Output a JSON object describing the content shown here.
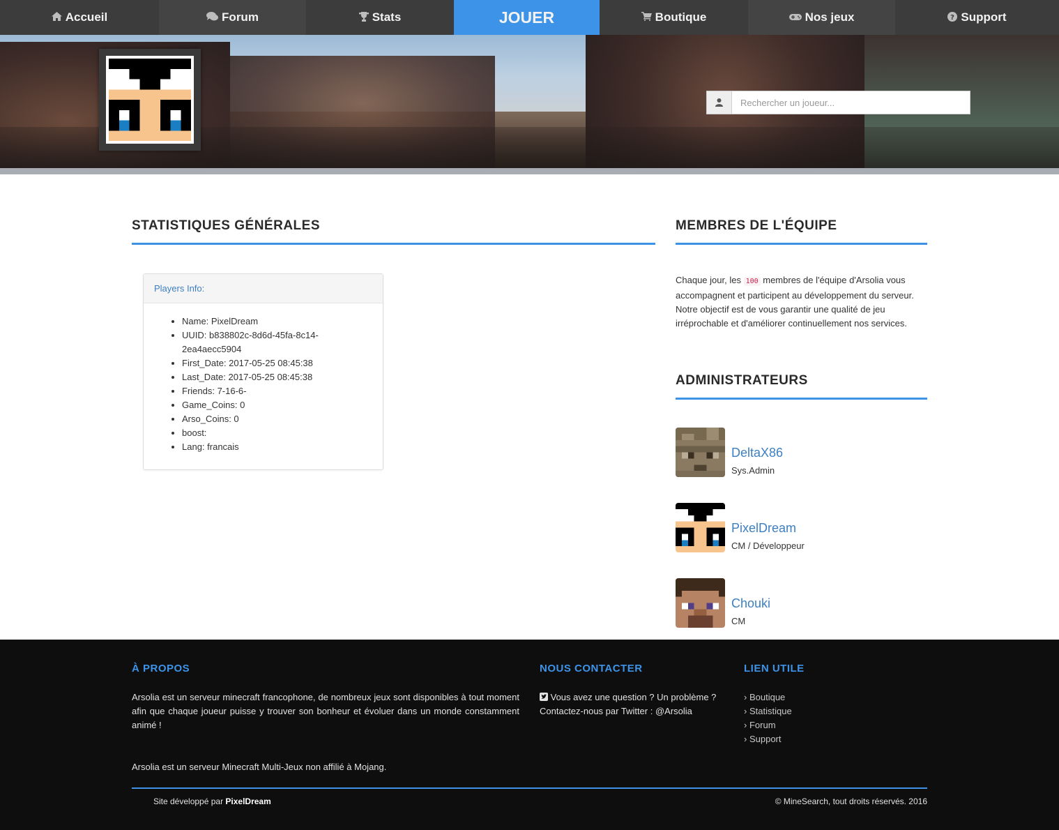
{
  "nav": {
    "items": [
      {
        "label": "Accueil",
        "icon": "home-icon"
      },
      {
        "label": "Forum",
        "icon": "comments-icon"
      },
      {
        "label": "Stats",
        "icon": "trophy-icon"
      },
      {
        "label": "JOUER",
        "icon": ""
      },
      {
        "label": "Boutique",
        "icon": "cart-icon"
      },
      {
        "label": "Nos jeux",
        "icon": "gamepad-icon"
      },
      {
        "label": "Support",
        "icon": "question-circle-icon"
      }
    ],
    "active_index": 3,
    "accent_color": "#3d93e8"
  },
  "header": {
    "search_placeholder": "Rechercher un joueur..."
  },
  "stats": {
    "title": "STATISTIQUES GÉNÉRALES",
    "panel_title": "Players Info:",
    "items": [
      "Name: PixelDream",
      "UUID: b838802c-8d6d-45fa-8c14-2ea4aecc5904",
      "First_Date: 2017-05-25 08:45:38",
      "Last_Date: 2017-05-25 08:45:38",
      "Friends: 7-16-6-",
      "Game_Coins: 0",
      "Arso_Coins: 0",
      "boost:",
      "Lang: francais"
    ]
  },
  "team": {
    "title": "MEMBRES DE L'ÉQUIPE",
    "text_before": "Chaque jour, les ",
    "count": "100",
    "text_after": " membres de l'équipe d'Arsolia vous accompagnent et participent au développement du serveur. Notre objectif est de vous garantir une qualité de jeu irréprochable et d'améliorer continuellement nos services.",
    "admins_title": "ADMINISTRATEURS",
    "members": [
      {
        "name": "DeltaX86",
        "role": "Sys.Admin"
      },
      {
        "name": "PixelDream",
        "role": "CM / Développeur"
      },
      {
        "name": "Chouki",
        "role": "CM"
      }
    ]
  },
  "footer": {
    "about_title": "À PROPOS",
    "about_text": "Arsolia est un serveur minecraft francophone, de nombreux jeux sont disponibles à tout moment afin que chaque joueur puisse y trouver son bonheur et évoluer dans un monde constamment animé !",
    "disclaimer": "Arsolia est un serveur Minecraft Multi-Jeux non affilié à Mojang.",
    "contact_title": "NOUS CONTACTER",
    "contact_text": "Vous avez une question ? Un problème ? Contactez-nous par Twitter : @Arsolia",
    "links_title": "LIEN UTILE",
    "links": [
      "Boutique",
      "Statistique",
      "Forum",
      "Support"
    ],
    "credit_prefix": "Site développé par ",
    "credit_name": "PixelDream",
    "copyright": "© MineSearch, tout droits réservés. 2016"
  }
}
